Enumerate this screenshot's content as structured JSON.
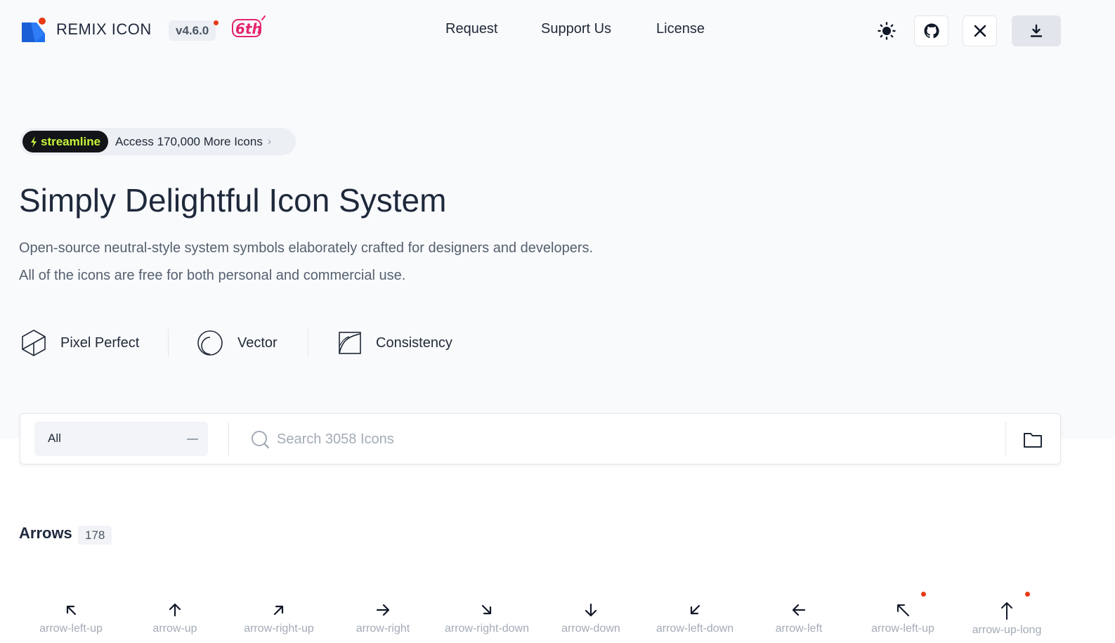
{
  "header": {
    "brand": "REMIX ICON",
    "version": "v4.6.0",
    "anniversary": "6th",
    "nav": [
      "Request",
      "Support Us",
      "License"
    ],
    "actions": [
      "theme-toggle",
      "github",
      "x",
      "download"
    ]
  },
  "promo": {
    "badge": "streamline",
    "text": "Access 170,000 More Icons"
  },
  "hero": {
    "title": "Simply Delightful Icon System",
    "line1": "Open-source neutral-style system symbols elaborately crafted for designers and developers.",
    "line2": "All of the icons are free for both personal and commercial use."
  },
  "features": [
    {
      "label": "Pixel Perfect",
      "icon": "cube-icon"
    },
    {
      "label": "Vector",
      "icon": "vector-circle-icon"
    },
    {
      "label": "Consistency",
      "icon": "curve-grid-icon"
    }
  ],
  "search": {
    "category": "All",
    "placeholder": "Search 3058 Icons"
  },
  "category": {
    "name": "Arrows",
    "count": "178",
    "icons": [
      {
        "name": "arrow-left-up",
        "new": false
      },
      {
        "name": "arrow-up",
        "new": false
      },
      {
        "name": "arrow-right-up",
        "new": false
      },
      {
        "name": "arrow-right",
        "new": false
      },
      {
        "name": "arrow-right-down",
        "new": false
      },
      {
        "name": "arrow-down",
        "new": false
      },
      {
        "name": "arrow-left-down",
        "new": false
      },
      {
        "name": "arrow-left",
        "new": false
      },
      {
        "name": "arrow-left-up",
        "new": true
      },
      {
        "name": "arrow-up-long",
        "new": true
      }
    ]
  },
  "colors": {
    "accent": "#1d6ff2",
    "dot": "#e83a14",
    "streamline_green": "#c7f53a",
    "text": "#1e293b"
  }
}
